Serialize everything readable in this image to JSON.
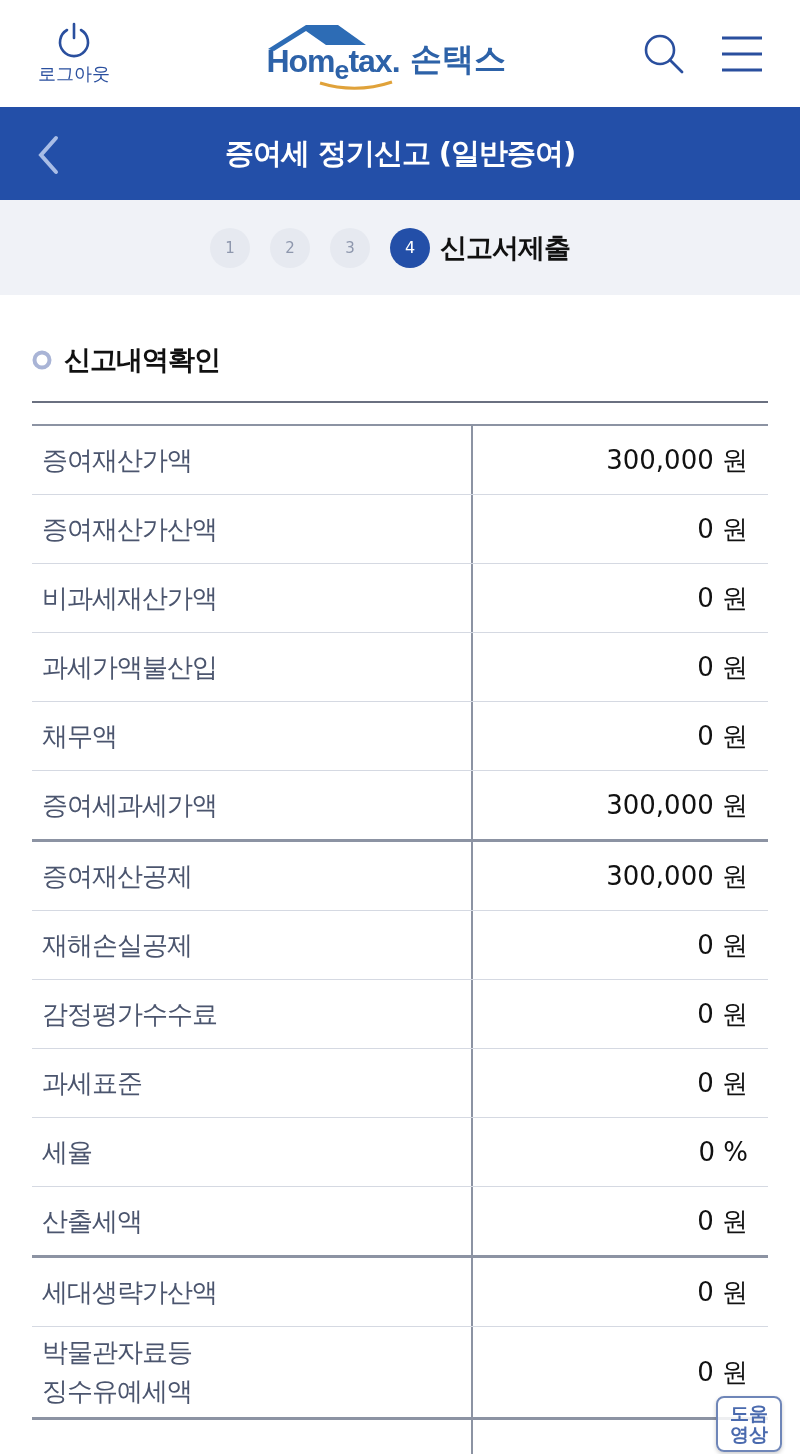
{
  "header": {
    "logout_label": "로그아웃",
    "logo_text": "Hom$_{e}$tax.",
    "logo_suffix": "손택스"
  },
  "title_bar": {
    "title": "증여세 정기신고 (일반증여)"
  },
  "steps": [
    {
      "number": "1",
      "selected": false
    },
    {
      "number": "2",
      "selected": false
    },
    {
      "number": "3",
      "selected": false
    },
    {
      "number": "4",
      "selected": true,
      "title": "신고서제출"
    }
  ],
  "section": {
    "title": "신고내역확인"
  },
  "table": {
    "groups": [
      [
        {
          "label": "증여재산가액",
          "value": "300,000 원"
        },
        {
          "label": "증여재산가산액",
          "value": "0 원"
        },
        {
          "label": "비과세재산가액",
          "value": "0 원"
        },
        {
          "label": "과세가액불산입",
          "value": "0 원"
        },
        {
          "label": "채무액",
          "value": "0 원"
        },
        {
          "label": "증여세과세가액",
          "value": "300,000 원"
        }
      ],
      [
        {
          "label": "증여재산공제",
          "value": "300,000 원"
        },
        {
          "label": "재해손실공제",
          "value": "0 원"
        },
        {
          "label": "감정평가수수료",
          "value": "0 원"
        },
        {
          "label": "과세표준",
          "value": "0 원"
        },
        {
          "label": "세율",
          "value": "0 %"
        },
        {
          "label": "산출세액",
          "value": "0 원"
        }
      ],
      [
        {
          "label": "세대생략가산액",
          "value": "0 원"
        },
        {
          "label": "박물관자료등\n징수유예세액",
          "value": "0 원"
        }
      ]
    ]
  },
  "help_button": {
    "label": "도움\n영상"
  }
}
